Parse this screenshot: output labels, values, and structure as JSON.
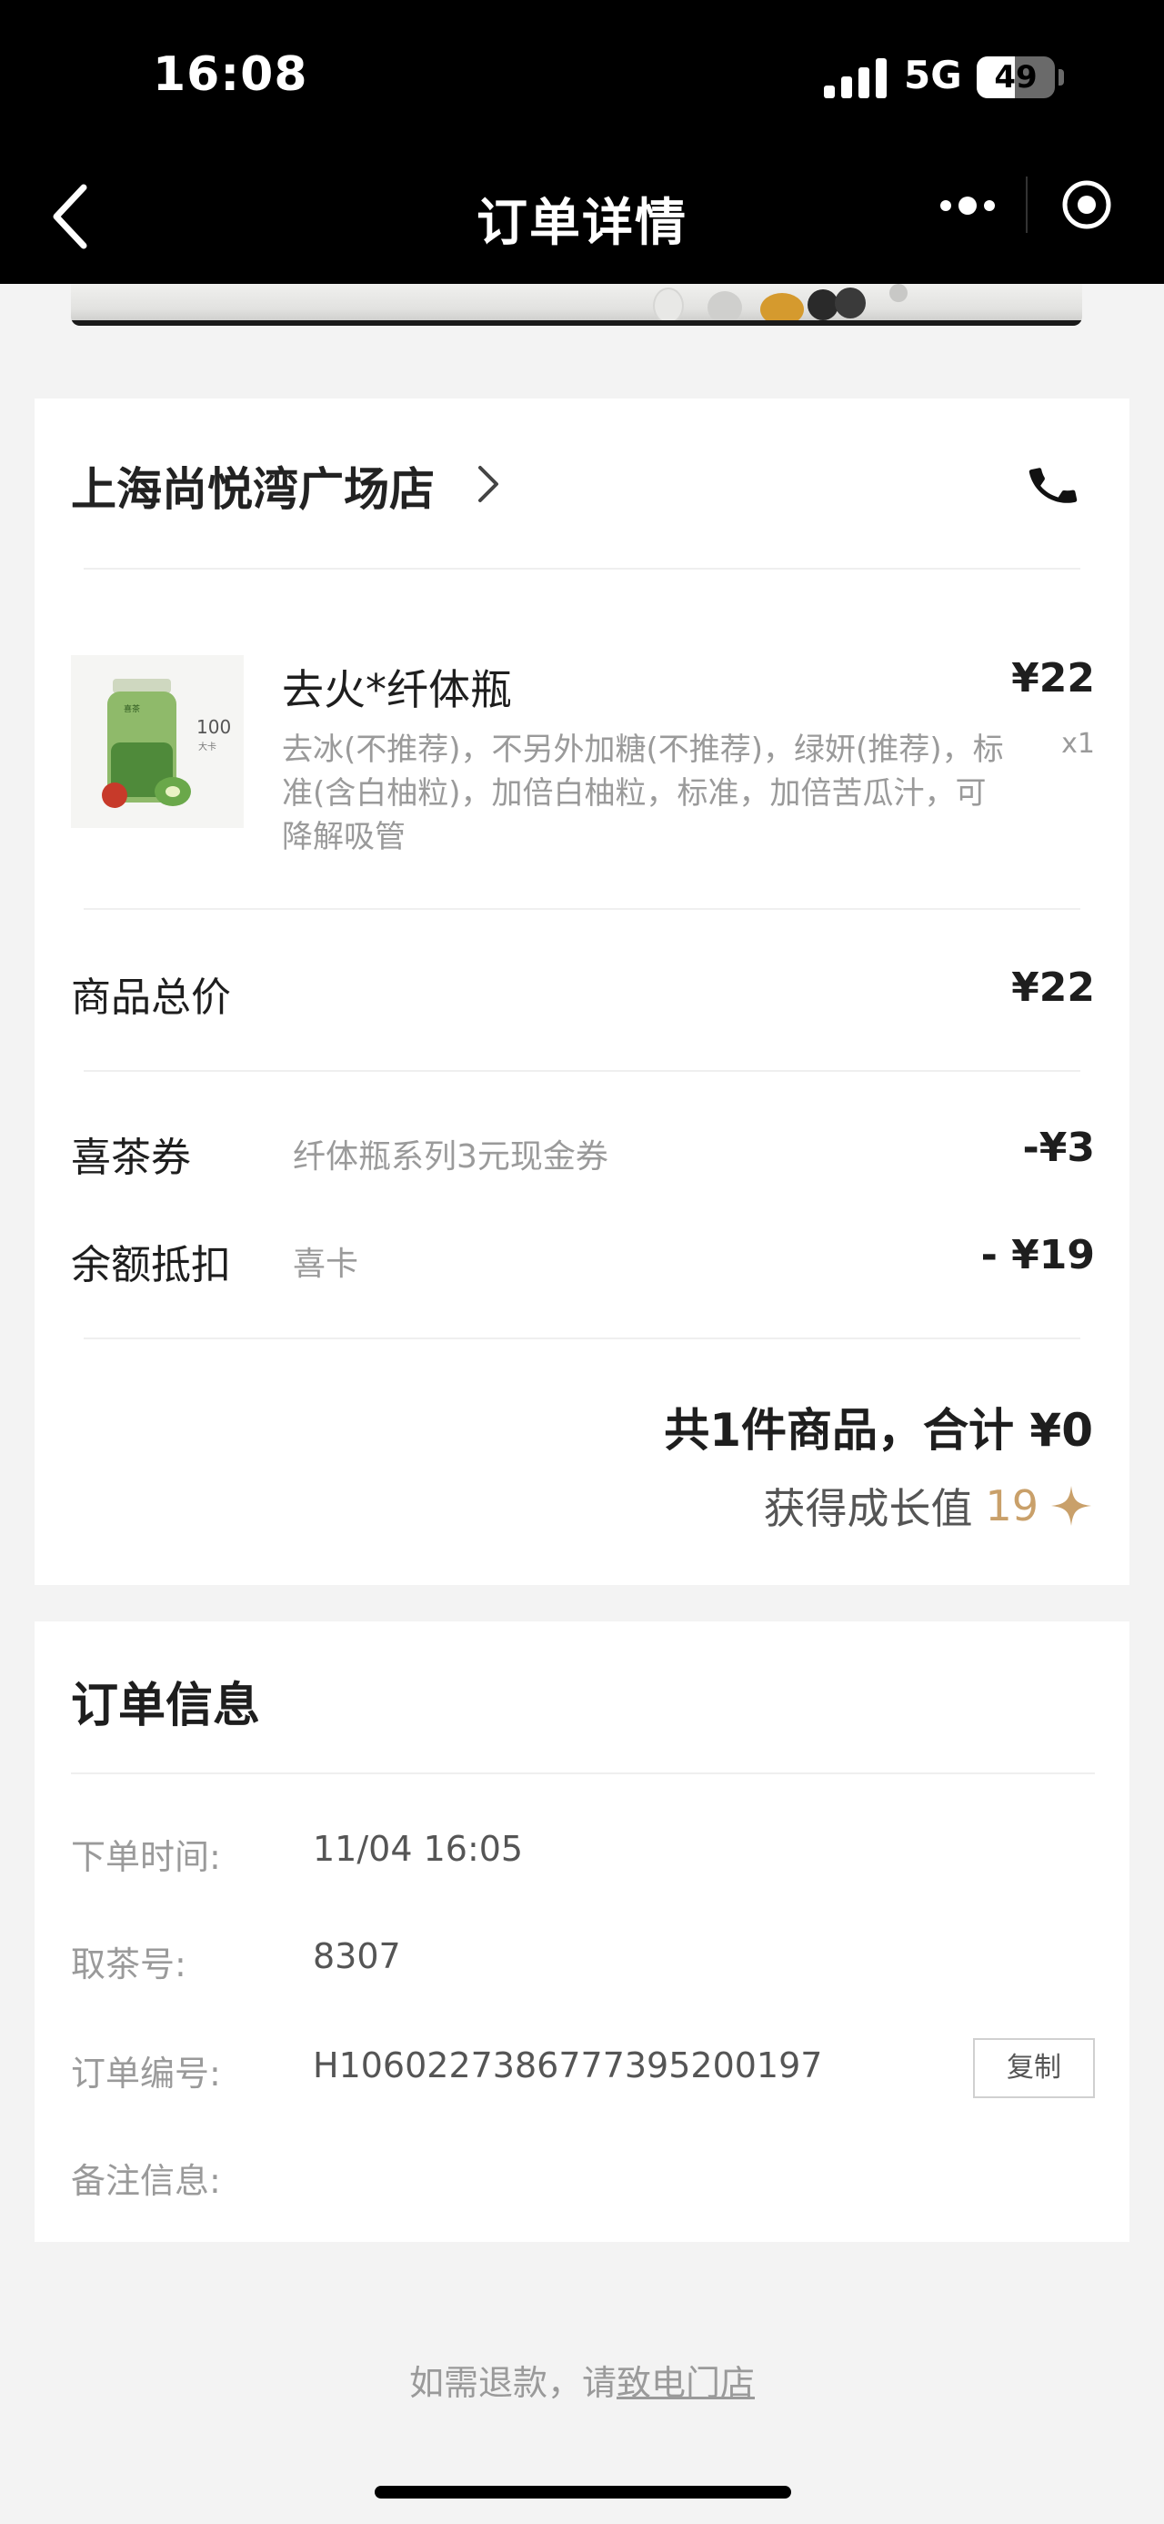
{
  "status_bar": {
    "time": "16:08",
    "network": "5G",
    "battery": "49",
    "battery_level": 0.49
  },
  "nav": {
    "title": "订单详情"
  },
  "store": {
    "name": "上海尚悦湾广场店"
  },
  "product": {
    "name": "去火*纤体瓶",
    "price": "¥22",
    "qty": "x1",
    "options": "去冰(不推荐)，不另外加糖(不推荐)，绿妍(推荐)，标准(含白柚粒)，加倍白柚粒，标准，加倍苦瓜汁，可降解吸管",
    "image_text": {
      "brand": "喜茶",
      "calories": "100",
      "calorie_unit": "大卡"
    }
  },
  "subtotal": {
    "label": "商品总价",
    "value": "¥22"
  },
  "coupon": {
    "label": "喜茶券",
    "detail": "纤体瓶系列3元现金券",
    "value": "-¥3"
  },
  "balance": {
    "label": "余额抵扣",
    "detail": "喜卡",
    "value": "- ¥19"
  },
  "summary": {
    "total_text": "共1件商品，合计 ¥0",
    "growth_label": "获得成长值",
    "growth_value": "19"
  },
  "order_info": {
    "title": "订单信息",
    "fields": [
      {
        "label": "下单时间:",
        "value": "11/04 16:05"
      },
      {
        "label": "取茶号:",
        "value": "8307"
      },
      {
        "label": "订单编号:",
        "value": "H1060227386777395200197"
      },
      {
        "label": "备注信息:",
        "value": ""
      }
    ],
    "copy_label": "复制"
  },
  "footer": {
    "refund_prefix": "如需退款，请",
    "refund_link": "致电门店"
  },
  "colors": {
    "header_bg": "#000000",
    "accent_gold": "#c9a06a",
    "page_bg": "#f3f3f3"
  }
}
